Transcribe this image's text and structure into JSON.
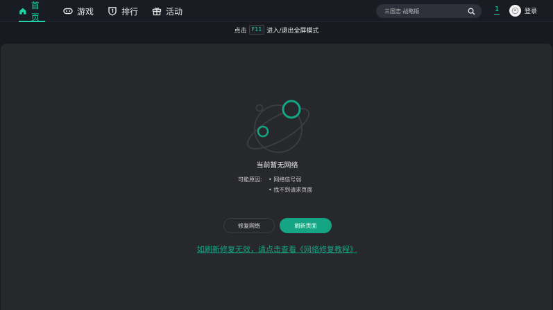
{
  "nav": {
    "items": [
      {
        "label": "首页",
        "icon": "home-icon",
        "active": true
      },
      {
        "label": "游戏",
        "icon": "gamepad-icon",
        "active": false
      },
      {
        "label": "排行",
        "icon": "rank-badge-icon",
        "active": false
      },
      {
        "label": "活动",
        "icon": "gift-icon",
        "active": false
      }
    ],
    "search": {
      "placeholder": "三国志·战略版"
    },
    "count": "1",
    "login_label": "登录"
  },
  "hint": {
    "prefix": "点击",
    "key": "F11",
    "suffix": "进入/退出全屏模式"
  },
  "error": {
    "title": "当前暂无网络",
    "reasons_label": "可能原因:",
    "reasons": [
      "• 网络信号弱",
      "• 找不到请求页面"
    ],
    "repair_label": "修复网络",
    "refresh_label": "刷新页面",
    "tutorial_link": "如刷新修复无效，请点击查看《网络修复教程》"
  },
  "colors": {
    "accent": "#20d3a8",
    "button": "#16a584",
    "background": "#181a20",
    "panel": "#27282c"
  }
}
